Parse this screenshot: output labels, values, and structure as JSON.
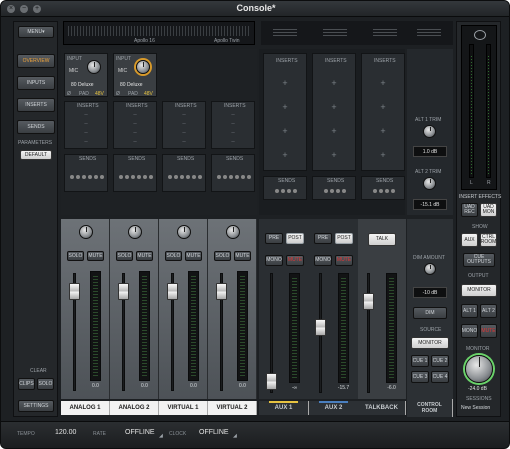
{
  "window": {
    "title": "Console*"
  },
  "titlebar": {
    "close": "×",
    "minimize": "−",
    "zoom": "+"
  },
  "top_strip": {
    "left_caption": "Apollo 16",
    "right_caption": "Apollo Twin"
  },
  "sidebar": {
    "menu_label": "MENU",
    "nav": [
      "OVERVIEW",
      "INPUTS",
      "INSERTS",
      "SENDS"
    ],
    "parameters_label": "PARAMETERS",
    "default_label": "DEFAULT",
    "clear_label": "CLEAR",
    "clips_label": "CLIPS",
    "solo_label": "SOLO",
    "settings_label": "SETTINGS"
  },
  "channels": [
    {
      "name": "ANALOG 1",
      "input_label": "INPUT",
      "mic_label": "MIC",
      "preset": "80 Deluxe",
      "meter_value": "0.0"
    },
    {
      "name": "ANALOG 2",
      "input_label": "INPUT",
      "mic_label": "MIC",
      "preset": "80 Deluxe",
      "meter_value": "0.0"
    },
    {
      "name": "VIRTUAL 1",
      "meter_value": "0.0"
    },
    {
      "name": "VIRTUAL 2",
      "meter_value": "0.0"
    }
  ],
  "strip_labels": {
    "inserts": "INSERTS",
    "sends": "SENDS",
    "solo": "SOLO",
    "mute": "MUTE",
    "pre": "PRE",
    "post": "POST",
    "mono": "MONO",
    "plus": "+",
    "dash": "–",
    "phase": "Ø",
    "pad": "PAD",
    "low_cut": "48V"
  },
  "aux": [
    {
      "name": "AUX 1",
      "meter_value": "-∞"
    },
    {
      "name": "AUX 2",
      "meter_value": "-15.7"
    }
  ],
  "talkback": {
    "name": "TALKBACK",
    "talk_label": "TALK",
    "meter_value": "-6.0"
  },
  "control_room": {
    "name_line1": "CONTROL",
    "name_line2": "ROOM",
    "alt1_label": "ALT 1 TRIM",
    "alt1_value": "1.0 dB",
    "alt2_label": "ALT 2 TRIM",
    "alt2_value": "-15.1 dB",
    "dim_amount_label": "DIM AMOUNT",
    "dim_amount_value": "-10 dB",
    "dim_label": "DIM",
    "source_label": "SOURCE",
    "source_value": "MONITOR",
    "cue_buttons": [
      "CUE 1",
      "CUE 2",
      "CUE 3",
      "CUE 4"
    ]
  },
  "right_panel": {
    "meter_l": "L",
    "meter_r": "R",
    "insert_effects_label": "INSERT EFFECTS",
    "uad_rec": "UAD REC",
    "uad_mon": "UAD MON",
    "show_label": "SHOW",
    "aux_btn": "AUX",
    "ctrl_room_btn": "CTRL ROOM",
    "cue_outputs_btn": "CUE OUTPUTS",
    "output_label": "OUTPUT",
    "monitor_btn": "MONITOR",
    "alt1_btn": "ALT 1",
    "alt2_btn": "ALT 2",
    "mono_btn": "MONO",
    "mute_btn": "MUTE",
    "monitor_label": "MONITOR",
    "monitor_value": "-24.0 dB",
    "sessions_label": "SESSIONS",
    "session_name": "New Session"
  },
  "bottom": {
    "tempo_label": "TEMPO",
    "tempo_value": "120.00",
    "rate_label": "RATE",
    "rate_value": "OFFLINE",
    "clock_label": "CLOCK",
    "clock_value": "OFFLINE"
  },
  "colors": {
    "accent_green": "#6ad36a",
    "mute_red": "#e03434",
    "post_yellow": "#e7c341",
    "aux_blue": "#4a7fbf"
  }
}
